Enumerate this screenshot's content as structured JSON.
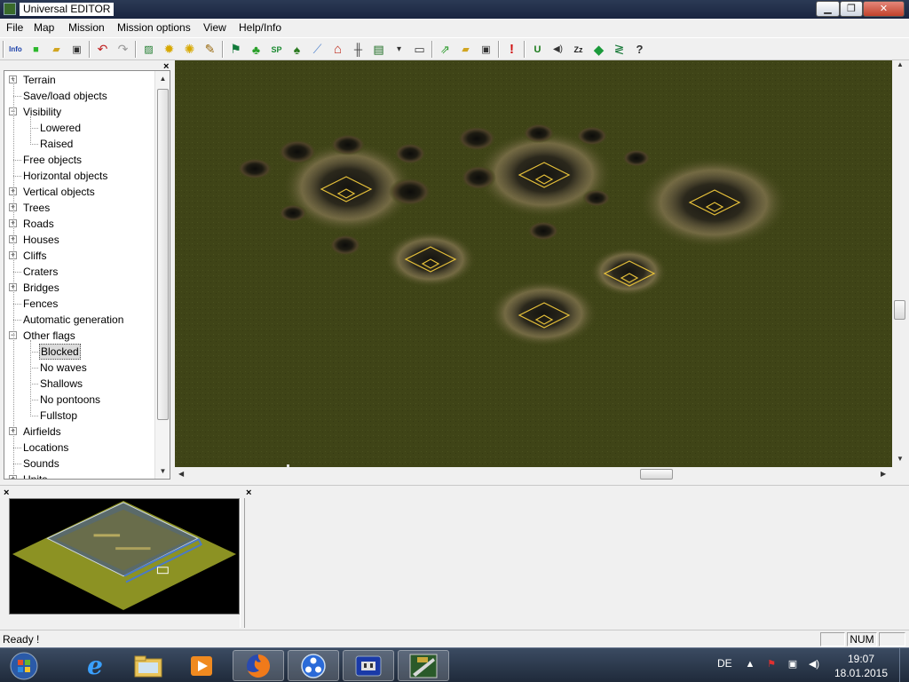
{
  "window": {
    "title": "Universal EDITOR",
    "minimize_label": "▁",
    "maximize_label": "❐",
    "close_label": "✕"
  },
  "menu": [
    "File",
    "Map",
    "Mission",
    "Mission options",
    "View",
    "Help/Info"
  ],
  "toolbar": {
    "buttons": [
      {
        "icon": "info-icon",
        "glyph": "Info"
      },
      {
        "icon": "new-icon",
        "glyph": "■"
      },
      {
        "icon": "open-folder-icon",
        "glyph": "▰"
      },
      {
        "icon": "save-icon",
        "glyph": "▣"
      },
      {
        "icon": "undo-icon",
        "glyph": "↶"
      },
      {
        "icon": "redo-icon",
        "glyph": "↷"
      },
      {
        "icon": "terrain-paint-icon",
        "glyph": "▨"
      },
      {
        "icon": "burst-icon",
        "glyph": "✹"
      },
      {
        "icon": "burst-small-icon",
        "glyph": "✺"
      },
      {
        "icon": "pencil-icon",
        "glyph": "✎"
      },
      {
        "icon": "flag-icon",
        "glyph": "⚑"
      },
      {
        "icon": "bush-icon",
        "glyph": "♣"
      },
      {
        "icon": "sp-icon",
        "glyph": "SP"
      },
      {
        "icon": "tree-icon",
        "glyph": "♠"
      },
      {
        "icon": "ruler-icon",
        "glyph": "⟋"
      },
      {
        "icon": "house-icon",
        "glyph": "⌂"
      },
      {
        "icon": "fence-icon",
        "glyph": "╫"
      },
      {
        "icon": "object-icon",
        "glyph": "▤"
      },
      {
        "icon": "dropdown-arrow-icon",
        "glyph": "▾"
      },
      {
        "icon": "train-icon",
        "glyph": "▭"
      },
      {
        "icon": "export-icon",
        "glyph": "⇗"
      },
      {
        "icon": "folder-open-icon",
        "glyph": "▰"
      },
      {
        "icon": "save-all-icon",
        "glyph": "▣"
      },
      {
        "icon": "alert-icon",
        "glyph": "!"
      },
      {
        "icon": "unit-icon",
        "glyph": "U"
      },
      {
        "icon": "speaker-icon",
        "glyph": "◀)"
      },
      {
        "icon": "zz-icon",
        "glyph": "Zz"
      },
      {
        "icon": "diamond-icon",
        "glyph": "◆"
      },
      {
        "icon": "zigzag-icon",
        "glyph": "≷"
      },
      {
        "icon": "help-icon",
        "glyph": "?"
      }
    ]
  },
  "tree": {
    "items": [
      {
        "label": "Terrain",
        "level": 0,
        "expander": "+"
      },
      {
        "label": "Save/load objects",
        "level": 0,
        "expander": ""
      },
      {
        "label": "Visibility",
        "level": 0,
        "expander": "−"
      },
      {
        "label": "Lowered",
        "level": 1,
        "expander": ""
      },
      {
        "label": "Raised",
        "level": 1,
        "expander": ""
      },
      {
        "label": "Free objects",
        "level": 0,
        "expander": ""
      },
      {
        "label": "Horizontal objects",
        "level": 0,
        "expander": ""
      },
      {
        "label": "Vertical objects",
        "level": 0,
        "expander": "+"
      },
      {
        "label": "Trees",
        "level": 0,
        "expander": "+"
      },
      {
        "label": "Roads",
        "level": 0,
        "expander": "+"
      },
      {
        "label": "Houses",
        "level": 0,
        "expander": "+"
      },
      {
        "label": "Cliffs",
        "level": 0,
        "expander": "+"
      },
      {
        "label": "Craters",
        "level": 0,
        "expander": ""
      },
      {
        "label": "Bridges",
        "level": 0,
        "expander": "+"
      },
      {
        "label": "Fences",
        "level": 0,
        "expander": ""
      },
      {
        "label": "Automatic generation",
        "level": 0,
        "expander": ""
      },
      {
        "label": "Other flags",
        "level": 0,
        "expander": "−"
      },
      {
        "label": "Blocked",
        "level": 1,
        "expander": "",
        "selected": true
      },
      {
        "label": "No waves",
        "level": 1,
        "expander": ""
      },
      {
        "label": "Shallows",
        "level": 1,
        "expander": ""
      },
      {
        "label": "No pontoons",
        "level": 1,
        "expander": ""
      },
      {
        "label": "Fullstop",
        "level": 1,
        "expander": ""
      },
      {
        "label": "Airfields",
        "level": 0,
        "expander": "+"
      },
      {
        "label": "Locations",
        "level": 0,
        "expander": ""
      },
      {
        "label": "Sounds",
        "level": 0,
        "expander": ""
      },
      {
        "label": "Units",
        "level": 0,
        "expander": "+"
      }
    ],
    "close_label": "×"
  },
  "panels": {
    "minimap_close": "×",
    "bottom_close": "×"
  },
  "status": {
    "text": "Ready !",
    "pane_empty": "",
    "num": "NUM"
  },
  "taskbar": {
    "apps": [
      {
        "icon": "start-orb-icon"
      },
      {
        "icon": "internet-explorer-icon"
      },
      {
        "icon": "file-explorer-icon"
      },
      {
        "icon": "media-player-icon"
      },
      {
        "icon": "firefox-icon"
      },
      {
        "icon": "blue-app-icon"
      },
      {
        "icon": "plug-app-icon"
      },
      {
        "icon": "universal-editor-icon"
      }
    ],
    "language": "DE",
    "time": "19:07",
    "date": "18.01.2015"
  },
  "colors": {
    "map_ground": "#3f4417",
    "marker_outline": "#e8c23a",
    "minimap_ground": "#8c9223"
  }
}
